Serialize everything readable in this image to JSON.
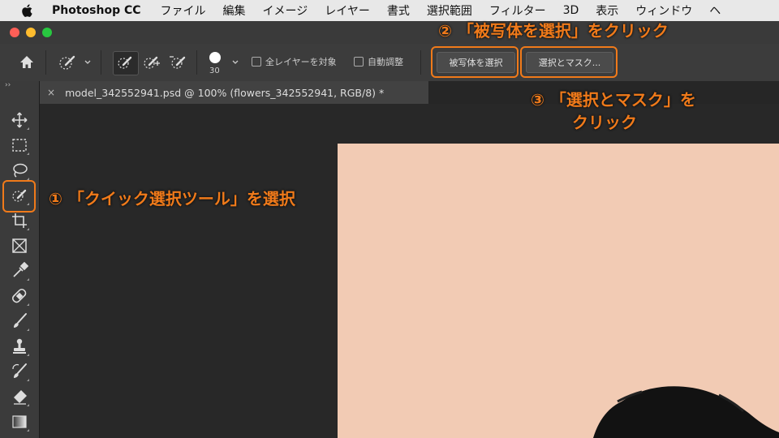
{
  "menubar": {
    "app_name": "Photoshop CC",
    "items": [
      "ファイル",
      "編集",
      "イメージ",
      "レイヤー",
      "書式",
      "選択範囲",
      "フィルター",
      "3D",
      "表示",
      "ウィンドウ",
      "ヘ"
    ]
  },
  "options_bar": {
    "brush_size": "30",
    "all_layers_label": "全レイヤーを対象",
    "auto_enhance_label": "自動調整",
    "select_subject_label": "被写体を選択",
    "select_and_mask_label": "選択とマスク..."
  },
  "document_tab": {
    "title": "model_342552941.psd @ 100% (flowers_342552941, RGB/8) *",
    "close": "×"
  },
  "annotations": {
    "step1": "① 「クイック選択ツール」を選択",
    "step2": "② 「被写体を選択」をクリック",
    "step3_line1": "③ 「選択とマスク」を",
    "step3_line2": "クリック"
  },
  "colors": {
    "highlight": "#f07a1a",
    "canvas": "#f2cbb4",
    "hair": "#121212"
  }
}
